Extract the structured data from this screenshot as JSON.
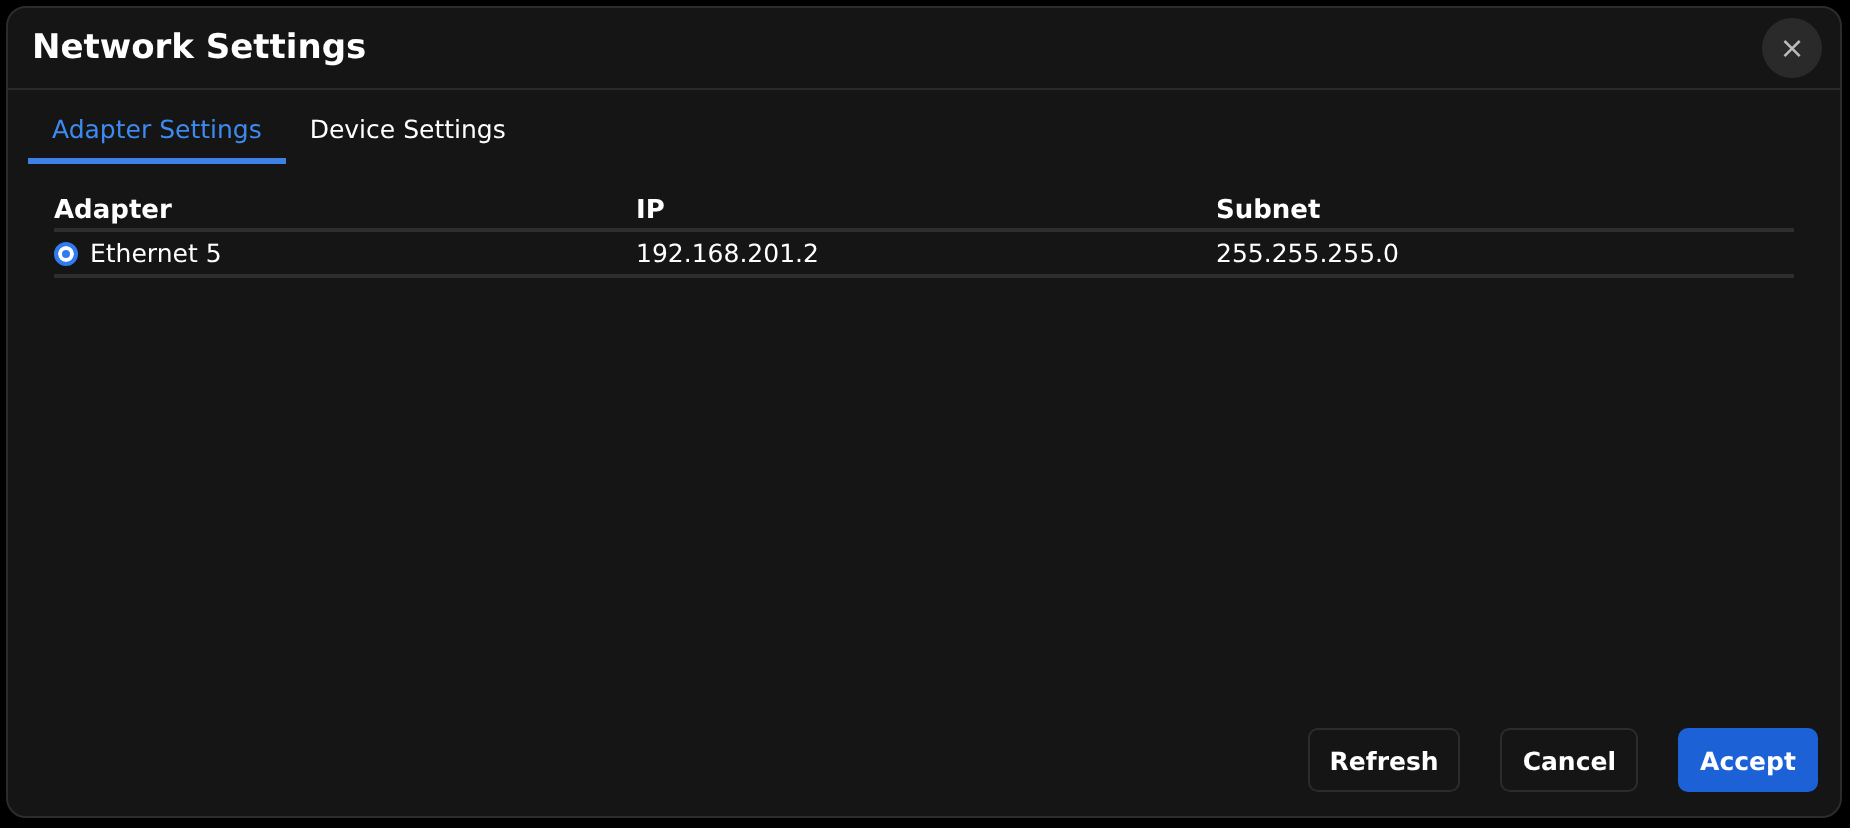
{
  "window": {
    "title": "Network Settings",
    "close": "×"
  },
  "tabs": [
    {
      "label": "Adapter Settings",
      "selected": true
    },
    {
      "label": "Device Settings",
      "selected": false
    }
  ],
  "table": {
    "columns": [
      "Adapter",
      "IP",
      "Subnet"
    ],
    "rows": [
      {
        "selected": true,
        "cells": [
          "Ethernet 5",
          "192.168.201.2",
          "255.255.255.0"
        ]
      }
    ]
  },
  "buttons": [
    {
      "label": "Refresh",
      "kind": "secondary"
    },
    {
      "label": "Cancel",
      "kind": "secondary"
    },
    {
      "label": "Accept",
      "kind": "primary"
    }
  ]
}
